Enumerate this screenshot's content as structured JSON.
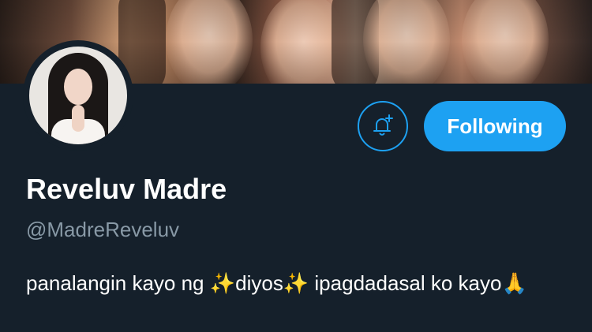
{
  "profile": {
    "display_name": "Reveluv Madre",
    "handle": "@MadreReveluv",
    "bio": "panalangin kayo ng ✨diyos✨ ipagdadasal ko kayo🙏"
  },
  "actions": {
    "follow_label": "Following",
    "notify_icon": "bell-plus-icon"
  },
  "colors": {
    "background": "#15202b",
    "accent": "#1da1f2",
    "secondary_text": "#8899a6",
    "primary_text": "#ffffff"
  }
}
